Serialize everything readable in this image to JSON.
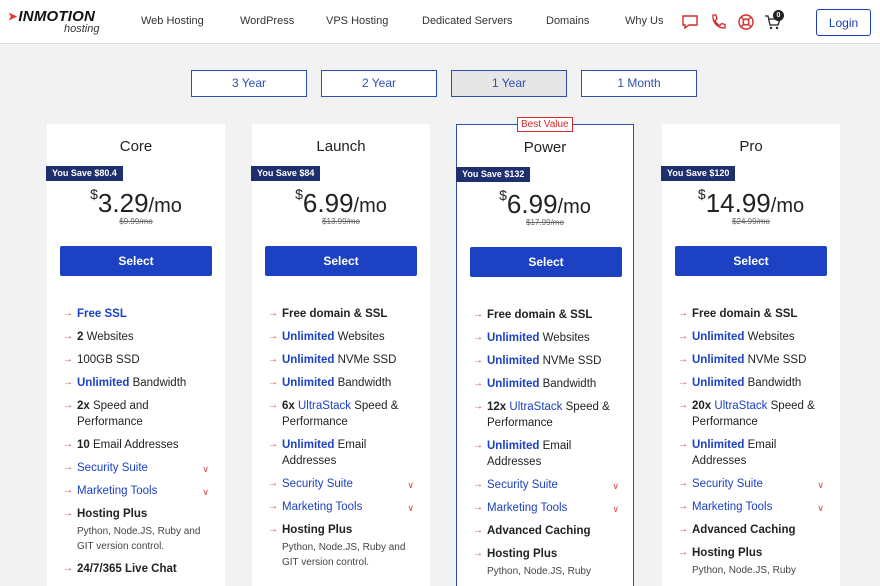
{
  "header": {
    "logo_main": "INMOTION",
    "logo_sub": "hosting",
    "nav": [
      "Web Hosting",
      "WordPress",
      "VPS Hosting",
      "Dedicated Servers",
      "Domains",
      "Why Us"
    ],
    "cart_count": "0",
    "login_label": "Login"
  },
  "terms": [
    {
      "label": "3 Year",
      "active": false
    },
    {
      "label": "2 Year",
      "active": false
    },
    {
      "label": "1 Year",
      "active": true
    },
    {
      "label": "1 Month",
      "active": false
    }
  ],
  "plans": [
    {
      "name": "Core",
      "save": "You Save $80.4",
      "price": "3.29",
      "per": "/mo",
      "old": "$9.99/mo",
      "select": "Select",
      "f": {
        "ssl": "Free SSL",
        "websites_n": "2",
        "websites_t": " Websites",
        "ssd": "100GB SSD",
        "bw_hl": "Unlimited",
        "bw_t": " Bandwidth",
        "speed_b": "2x",
        "speed_t": " Speed and Performance",
        "email_b": "10",
        "email_t": " Email Addresses",
        "security": "Security Suite",
        "marketing": "Marketing Tools",
        "hosting_plus": "Hosting Plus",
        "hosting_plus_sub": "Python, Node.JS,  Ruby and GIT version control.",
        "support": "24/7/365 Live Chat"
      }
    },
    {
      "name": "Launch",
      "save": "You Save $84",
      "price": "6.99",
      "per": "/mo",
      "old": "$13.99/mo",
      "select": "Select",
      "f": {
        "domain": "Free domain & SSL",
        "websites_hl": "Unlimited",
        "websites_t": " Websites",
        "nvme_hl": "Unlimited",
        "nvme_t": " NVMe SSD",
        "bw_hl": "Unlimited",
        "bw_t": " Bandwidth",
        "speed_b": "6x",
        "speed_u": " UltraStack",
        "speed_t": " Speed & Performance",
        "email_hl": "Unlimited",
        "email_t": " Email Addresses",
        "security": "Security Suite",
        "marketing": "Marketing Tools",
        "hosting_plus": "Hosting Plus",
        "hosting_plus_sub": "Python,  Node.JS,  Ruby and GIT version control."
      }
    },
    {
      "name": "Power",
      "badge": "Best Value",
      "save": "You Save $132",
      "price": "6.99",
      "per": "/mo",
      "old": "$17.99/mo",
      "select": "Select",
      "f": {
        "domain": "Free domain & SSL",
        "websites_hl": "Unlimited",
        "websites_t": " Websites",
        "nvme_hl": "Unlimited",
        "nvme_t": " NVMe SSD",
        "bw_hl": "Unlimited",
        "bw_t": " Bandwidth",
        "speed_b": "12x",
        "speed_u": " UltraStack",
        "speed_t": " Speed & Performance",
        "email_hl": "Unlimited",
        "email_t": " Email Addresses",
        "security": "Security Suite",
        "marketing": "Marketing Tools",
        "caching": "Advanced Caching",
        "hosting_plus": "Hosting Plus",
        "hosting_plus_sub": "Python,  Node.JS,  Ruby"
      }
    },
    {
      "name": "Pro",
      "save": "You Save $120",
      "price": "14.99",
      "per": "/mo",
      "old": "$24.99/mo",
      "select": "Select",
      "f": {
        "domain": "Free domain & SSL",
        "websites_hl": "Unlimited",
        "websites_t": " Websites",
        "nvme_hl": "Unlimited",
        "nvme_t": " NVMe SSD",
        "bw_hl": "Unlimited",
        "bw_t": " Bandwidth",
        "speed_b": "20x",
        "speed_u": " UltraStack",
        "speed_t": " Speed & Performance",
        "email_hl": "Unlimited",
        "email_t": " Email Addresses",
        "security": "Security Suite",
        "marketing": "Marketing Tools",
        "caching": "Advanced Caching",
        "hosting_plus": "Hosting Plus",
        "hosting_plus_sub": "Python,  Node.JS,  Ruby"
      }
    }
  ],
  "colors": {
    "accent": "#1c41c2",
    "save_tag": "#1e2f6e",
    "arrow": "#dd4444",
    "badge": "#d42a2a"
  }
}
